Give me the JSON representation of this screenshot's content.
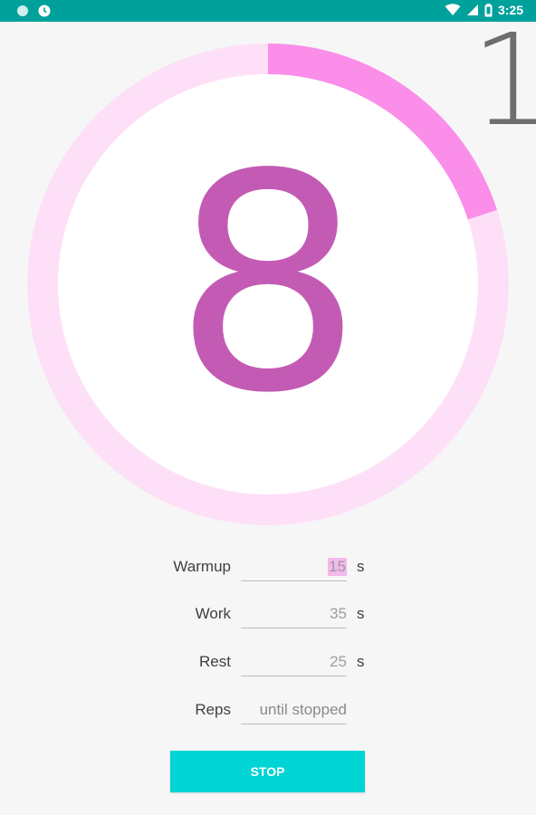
{
  "status_bar": {
    "time": "3:25",
    "left_icons": [
      "notification-dot-icon",
      "clock-icon"
    ],
    "right_icons": [
      "wifi-icon",
      "signal-icon",
      "battery-icon"
    ]
  },
  "timer": {
    "round_number": "1",
    "countdown": "8",
    "progress_fraction": 0.2,
    "colors": {
      "progress": "#fa8ee9",
      "track": "#fde0f8",
      "digit": "#c35bb4",
      "center": "#ffffff"
    }
  },
  "settings": {
    "warmup": {
      "label": "Warmup",
      "value": "15",
      "unit": "s"
    },
    "work": {
      "label": "Work",
      "value": "35",
      "unit": "s"
    },
    "rest": {
      "label": "Rest",
      "value": "25",
      "unit": "s"
    },
    "reps": {
      "label": "Reps",
      "placeholder": "until stopped"
    }
  },
  "actions": {
    "stop_label": "STOP",
    "stop_color": "#00d4d4"
  }
}
